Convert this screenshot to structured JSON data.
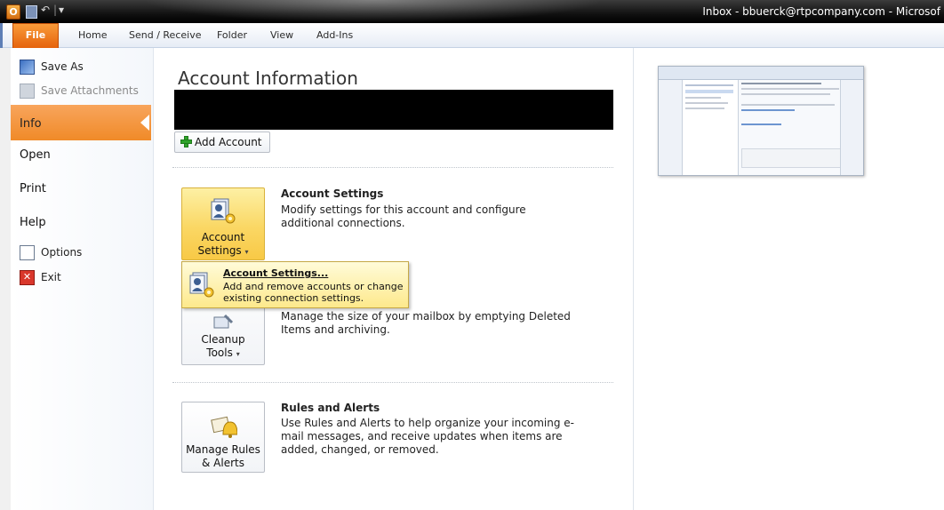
{
  "window": {
    "title": "Inbox - bbuerck@rtpcompany.com - Microsof",
    "qat_undo": "↶",
    "qat_sep": "|",
    "qat_dropdown": "▾"
  },
  "ribbon": {
    "file_label": "File",
    "tabs": [
      "Home",
      "Send / Receive",
      "Folder",
      "View",
      "Add-Ins"
    ]
  },
  "backstage": {
    "save_as": "Save As",
    "save_attachments": "Save Attachments",
    "info": "Info",
    "open": "Open",
    "print": "Print",
    "help": "Help",
    "options": "Options",
    "exit": "Exit"
  },
  "account": {
    "title": "Account Information",
    "add_account": "Add Account"
  },
  "sections": {
    "account_settings": {
      "title": "Account Settings",
      "desc": "Modify settings for this account and configure additional connections.",
      "button_line1": "Account",
      "button_line2": "Settings"
    },
    "cleanup": {
      "desc": "Manage the size of your mailbox by emptying Deleted Items and archiving.",
      "button_line1": "Cleanup",
      "button_line2": "Tools"
    },
    "rules": {
      "title": "Rules and Alerts",
      "desc": "Use Rules and Alerts to help organize your incoming e-mail messages, and receive updates when items are added, changed, or removed.",
      "button_line1": "Manage Rules",
      "button_line2": "& Alerts"
    }
  },
  "dropdown_menu": {
    "title": "Account Settings...",
    "desc": "Add and remove accounts or change existing connection settings."
  },
  "icons": {
    "dropdown_arrow": "▾",
    "exit_glyph": "✕"
  },
  "colors": {
    "file_tab": "#e5630c",
    "info_selected": "#f39a3e",
    "hover_button": "#fad764",
    "title_bar": "#111111"
  }
}
